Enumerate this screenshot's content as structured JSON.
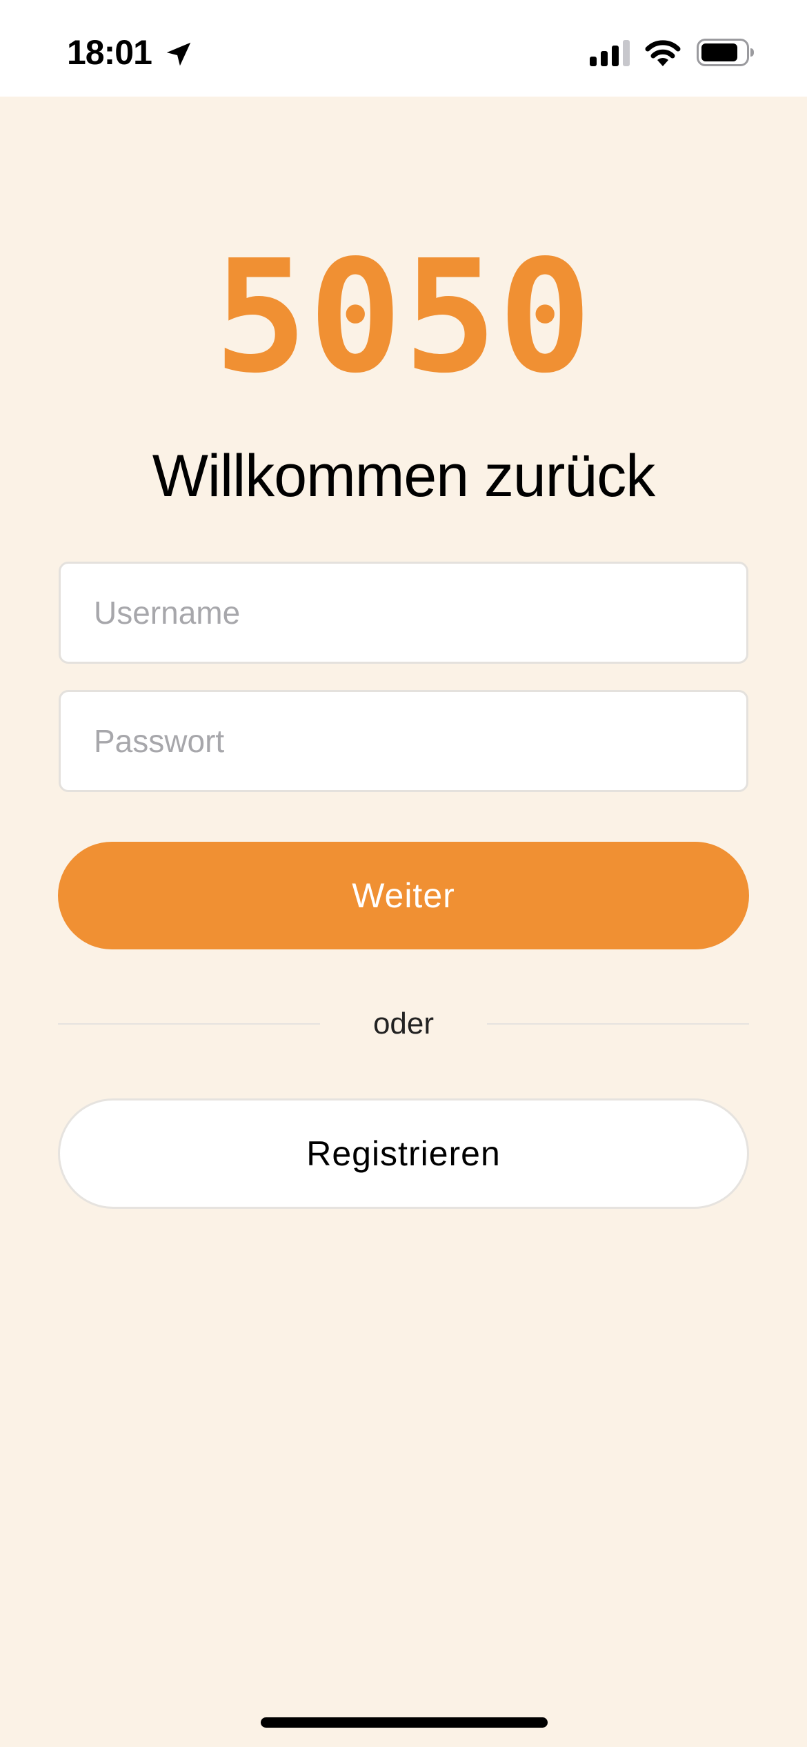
{
  "status_bar": {
    "time": "18:01",
    "icons": [
      "location-arrow-icon",
      "cellular-signal-icon",
      "wifi-icon",
      "battery-icon"
    ]
  },
  "login": {
    "logo_text": "5050",
    "title": "Willkommen zurück",
    "username_placeholder": "Username",
    "password_placeholder": "Passwort",
    "submit_label": "Weiter",
    "divider_text": "oder",
    "register_label": "Registrieren"
  },
  "colors": {
    "accent": "#F09033",
    "background": "#FBF2E6",
    "surface": "#FFFFFF",
    "placeholder": "#A7A7AB"
  }
}
